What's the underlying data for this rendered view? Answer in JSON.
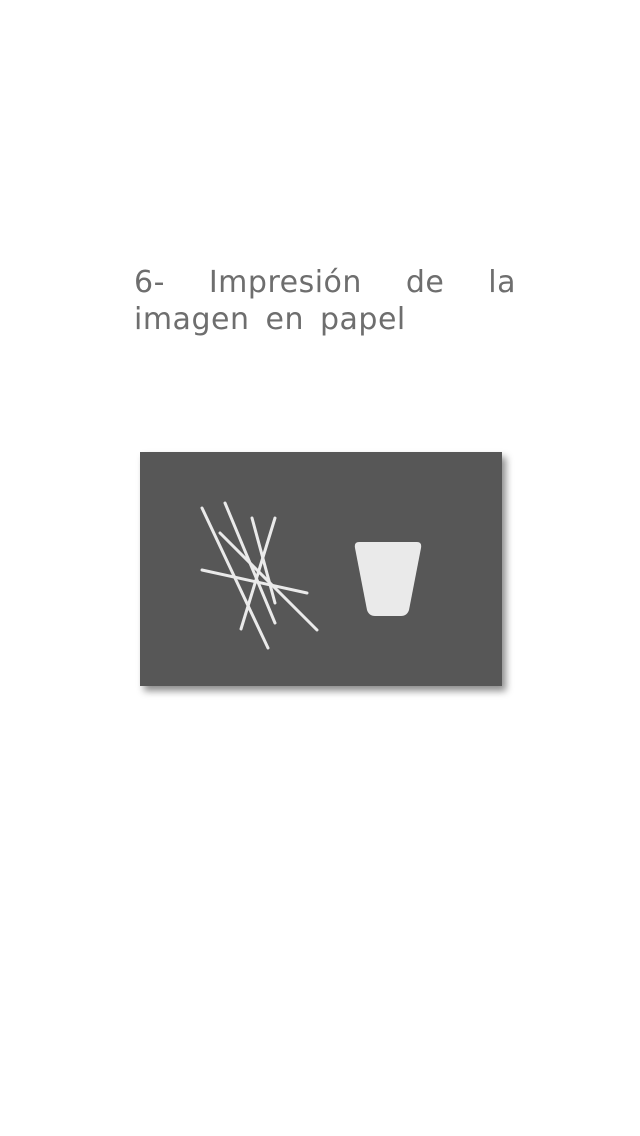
{
  "step": {
    "title": "6- Impresión de la imagen en papel"
  },
  "illustration": {
    "paper_color": "#575757",
    "drawing_color": "#eaeaea",
    "icons": [
      "scribble-lines-icon",
      "cup-icon"
    ]
  }
}
